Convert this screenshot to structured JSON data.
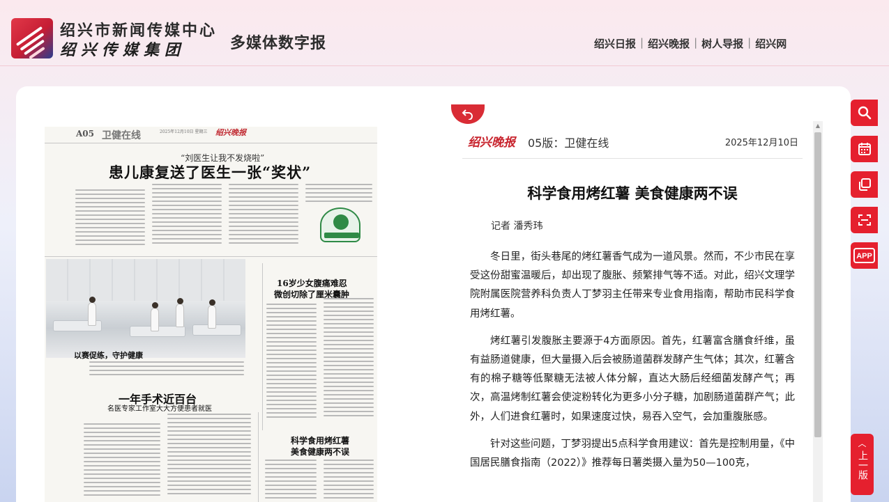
{
  "header": {
    "org_name": "绍兴市新闻传媒中心",
    "org_group": "绍兴传媒集团",
    "site_title": "多媒体数字报",
    "nav": [
      "绍兴日报",
      "绍兴晚报",
      "树人导报",
      "绍兴网"
    ]
  },
  "paper_page": {
    "edition_no": "A05",
    "edition_name": "卫健在线",
    "mast_meta": "2025年12月10日  星期三",
    "mast_brand": "绍兴晚报",
    "kicker": "“刘医生让我不发烧啦”",
    "headline": "患儿康复送了医生一张“奖状”",
    "photo_caption": "以赛促练，守护健康",
    "story2_title_1": "16岁少女腹痛难忍",
    "story2_title_2": "微创切除了厘米囊肿",
    "story3_title": "一年手术近百台",
    "story3_subtitle": "名医专家工作室大大方便患者就医",
    "story4_title_1": "科学食用烤红薯",
    "story4_title_2": "美食健康两不误"
  },
  "article": {
    "brand": "绍兴晚报",
    "edition": "05版：卫健在线",
    "date": "2025年12月10日",
    "title": "科学食用烤红薯 美食健康两不误",
    "author": "记者 潘秀玮",
    "paragraphs": [
      "冬日里，街头巷尾的烤红薯香气成为一道风景。然而，不少市民在享受这份甜蜜温暖后，却出现了腹胀、频繁排气等不适。对此，绍兴文理学院附属医院营养科负责人丁梦羽主任带来专业食用指南，帮助市民科学食用烤红薯。",
      "烤红薯引发腹胀主要源于4方面原因。首先，红薯富含膳食纤维，虽有益肠道健康，但大量摄入后会被肠道菌群发酵产生气体；其次，红薯含有的棉子糖等低聚糖无法被人体分解，直达大肠后经细菌发酵产气；再次，高温烤制红薯会使淀粉转化为更多小分子糖，加剧肠道菌群产气；此外，人们进食红薯时，如果速度过快，易吞入空气，会加重腹胀感。",
      "针对这些问题，丁梦羽提出5点科学食用建议：首先是控制用量，《中国居民膳食指南（2022）》推荐每日薯类摄入量为50—100克，"
    ]
  },
  "toolbar": {
    "icons": [
      "search-icon",
      "calendar-icon",
      "copy-icon",
      "scan-icon",
      "app-icon"
    ],
    "app_label": "APP",
    "prev_label": "上一版"
  },
  "colors": {
    "accent": "#e5202e",
    "brand_red": "#c8242e"
  }
}
